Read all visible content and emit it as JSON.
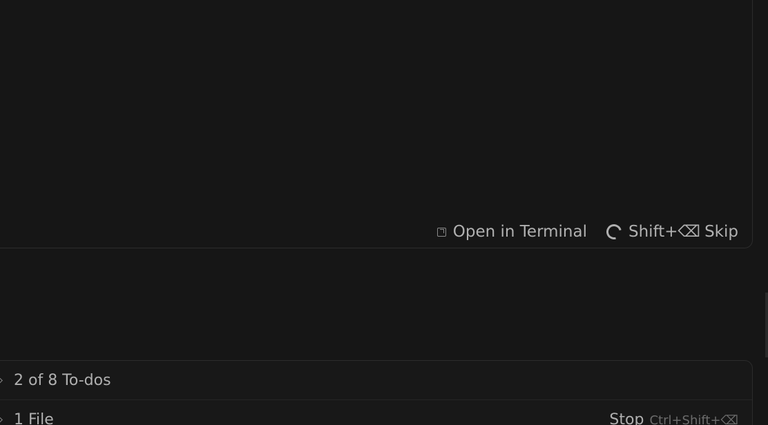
{
  "terminal": {
    "open_label": "Open in Terminal",
    "shortcut": "Shift+⌫",
    "skip_label": "Skip"
  },
  "status": {
    "todos_label": "2 of 8 To-dos",
    "files_label": "1 File",
    "stop_label": "Stop",
    "stop_shortcut": "Ctrl+Shift+⌫"
  },
  "icons": {
    "open": "external-open-icon",
    "spinner": "spinner-icon",
    "chevron": "chevron-right-icon"
  },
  "colors": {
    "background": "#161616",
    "border": "#2c2c2c",
    "text": "#b0b0b0",
    "muted": "#6b6b6b"
  }
}
